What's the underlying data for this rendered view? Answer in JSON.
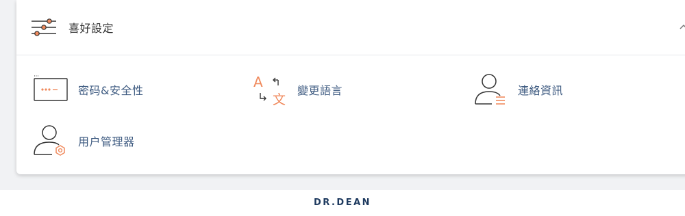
{
  "header": {
    "title": "喜好設定",
    "icon": "sliders-icon",
    "collapse_icon": "chevron-up-icon"
  },
  "items": [
    {
      "label": "密码&安全性",
      "icon": "password-field-icon"
    },
    {
      "label": "變更語言",
      "icon": "translate-icon"
    },
    {
      "label": "連絡資訊",
      "icon": "contact-info-icon"
    },
    {
      "label": "用户管理器",
      "icon": "user-manager-icon"
    }
  ],
  "footer": {
    "logo_text": "DR.DEAN"
  },
  "colors": {
    "accent": "#f08a5d",
    "label": "#3d5a80",
    "icon_line": "#333333"
  }
}
